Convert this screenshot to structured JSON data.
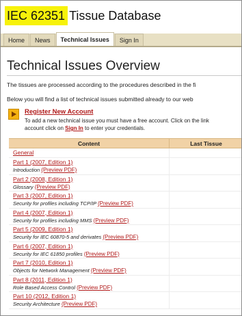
{
  "header": {
    "highlight": "IEC 62351",
    "title_rest": "Tissue Database"
  },
  "nav": {
    "tabs": [
      {
        "label": "Home"
      },
      {
        "label": "News"
      },
      {
        "label": "Technical Issues"
      },
      {
        "label": "Sign In"
      }
    ],
    "active_tab": "Technical Issues"
  },
  "page": {
    "title": "Technical Issues Overview",
    "intro1": "The tissues are processed according to the procedures described in the fi",
    "intro2": "Below you will find a list of technical issues submitted already to our web"
  },
  "register": {
    "link": "Register New Account",
    "desc_line1": "To add a new technical issue you must have a free account. Click on the link",
    "desc_line2_pre": "account click on ",
    "signin_link": "Sign In",
    "desc_line2_post": " to enter your credentials."
  },
  "table": {
    "columns": [
      "Content",
      "Last Tissue"
    ],
    "general": "General",
    "rows": [
      {
        "part": "Part 1 (2007, Edition 1)",
        "desc": "Introduction",
        "preview": "(Preview PDF)"
      },
      {
        "part": "Part 2 (2008, Edition 1)",
        "desc": "Glossary",
        "preview": "(Preview PDF)"
      },
      {
        "part": "Part 3 (2007, Edition 1)",
        "desc": "Security for profiles including TCP/IP",
        "preview": "(Preview PDF)"
      },
      {
        "part": "Part 4 (2007, Edition 1)",
        "desc": "Security for profiles including MMS",
        "preview": "(Preview PDF)"
      },
      {
        "part": "Part 5 (2009, Edition 1)",
        "desc": "Security for IEC 60870-5 and derivates",
        "preview": "(Preview PDF)"
      },
      {
        "part": "Part 6 (2007, Edition 1)",
        "desc": "Security for IEC 61850 profiles",
        "preview": "(Preview PDF)"
      },
      {
        "part": "Part 7 (2010, Edition 1)",
        "desc": "Objects for Network Management",
        "preview": "(Preview PDF)"
      },
      {
        "part": "Part 8 (2011, Edition 1)",
        "desc": "Role Based Access Control",
        "preview": "(Preview PDF)"
      },
      {
        "part": "Part 10 (2012, Edition 1)",
        "desc": "Security Architecture",
        "preview": "(Preview PDF)"
      }
    ]
  },
  "colors": {
    "highlight": "#f7f20a",
    "link": "#b01818",
    "table_header": "#f1d2a6",
    "nav_bar": "#e8e0c4",
    "register_icon": "#f5b20f"
  },
  "icons": {
    "register": "arrow-right-icon"
  }
}
